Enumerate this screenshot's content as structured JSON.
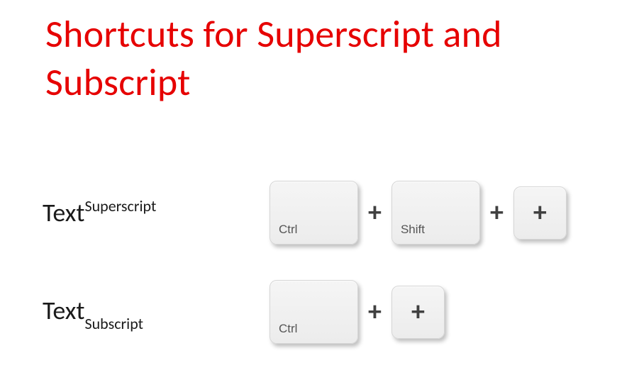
{
  "title": "Shortcuts for Superscript and Subscript",
  "rows": {
    "super": {
      "example_base": "Text",
      "example_script": "Superscript",
      "keys": [
        {
          "label": "Ctrl",
          "type": "wide"
        },
        {
          "label": "Shift",
          "type": "wide"
        },
        {
          "label": "+",
          "type": "small"
        }
      ],
      "separator": "+"
    },
    "sub": {
      "example_base": "Text",
      "example_script": "Subscript",
      "keys": [
        {
          "label": "Ctrl",
          "type": "wide"
        },
        {
          "label": "+",
          "type": "small"
        }
      ],
      "separator": "+"
    }
  }
}
